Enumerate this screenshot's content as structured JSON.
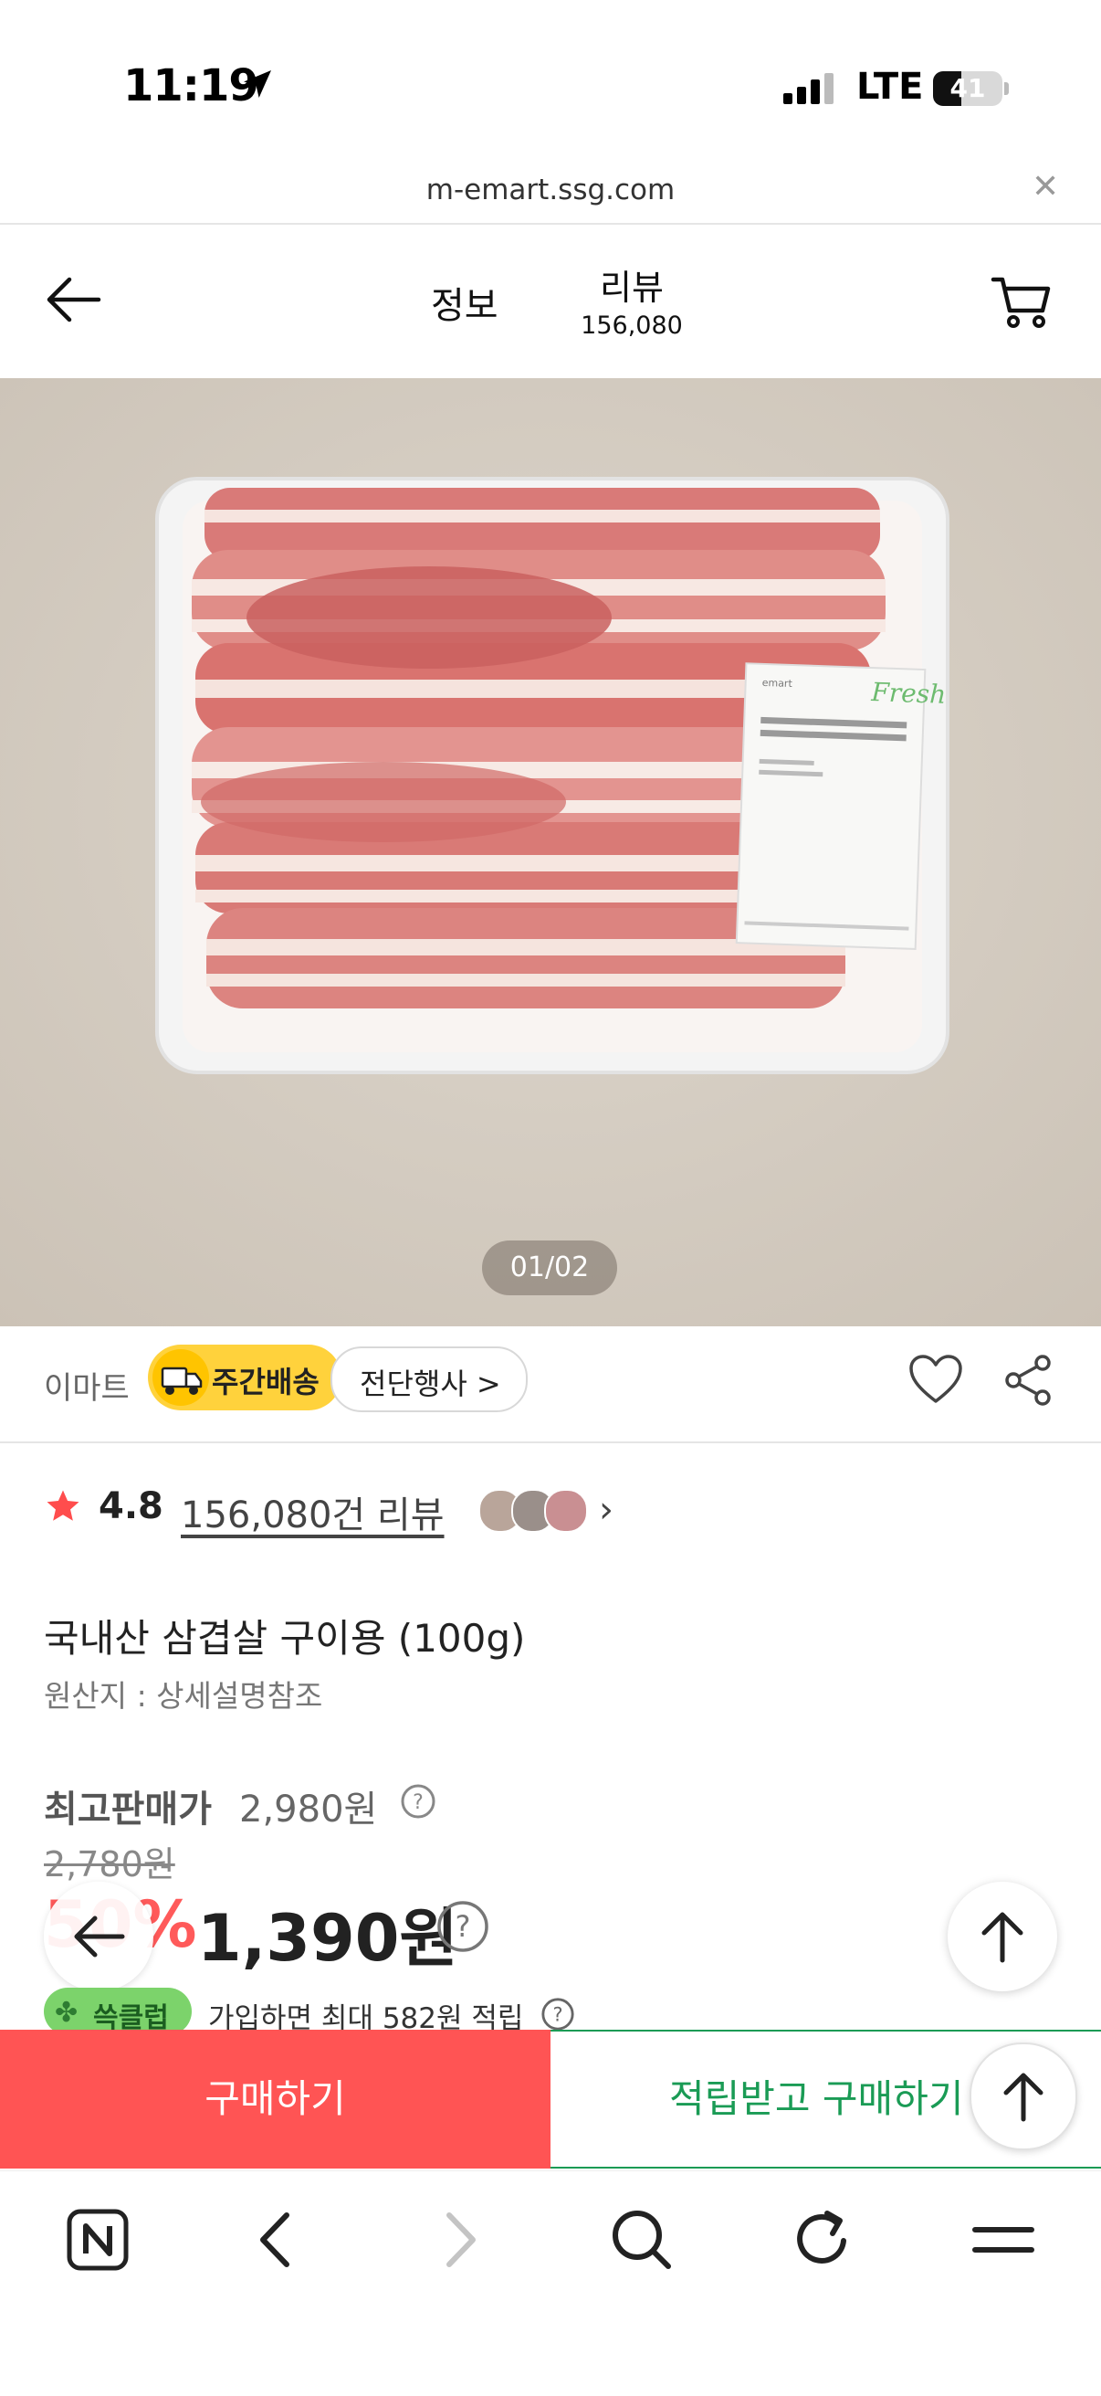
{
  "status": {
    "time": "11:19",
    "network": "LTE",
    "battery": "41",
    "battery_level": 0.41
  },
  "browser": {
    "url": "m-emart.ssg.com"
  },
  "header": {
    "tab_info": "정보",
    "tab_review": "리뷰",
    "review_count": "156,080"
  },
  "gallery": {
    "pager": "01/02"
  },
  "seller": {
    "name": "이마트",
    "delivery_badge": "주간배송",
    "store_link": "전단행사 >"
  },
  "rating": {
    "score": "4.8",
    "review_link": "156,080건 리뷰",
    "star_color": "#ff4d4d"
  },
  "product": {
    "name": "국내산 삼겹살 구이용 (100g)",
    "origin": "원산지 : 상세설명참조",
    "max_price_label": "최고판매가",
    "max_price": "2,980원",
    "original_price": "2,780원",
    "discount": "50%",
    "sale_price": "1,390원"
  },
  "benefit": {
    "badge": "쓱클럽",
    "description": "가입하면 최대 582원 적립"
  },
  "actions": {
    "buy": "구매하기",
    "earn_buy": "적립받고 구매하기"
  },
  "colors": {
    "buy": "#ff5454",
    "earn": "#1a9b55",
    "badge": "#ffd23c"
  }
}
